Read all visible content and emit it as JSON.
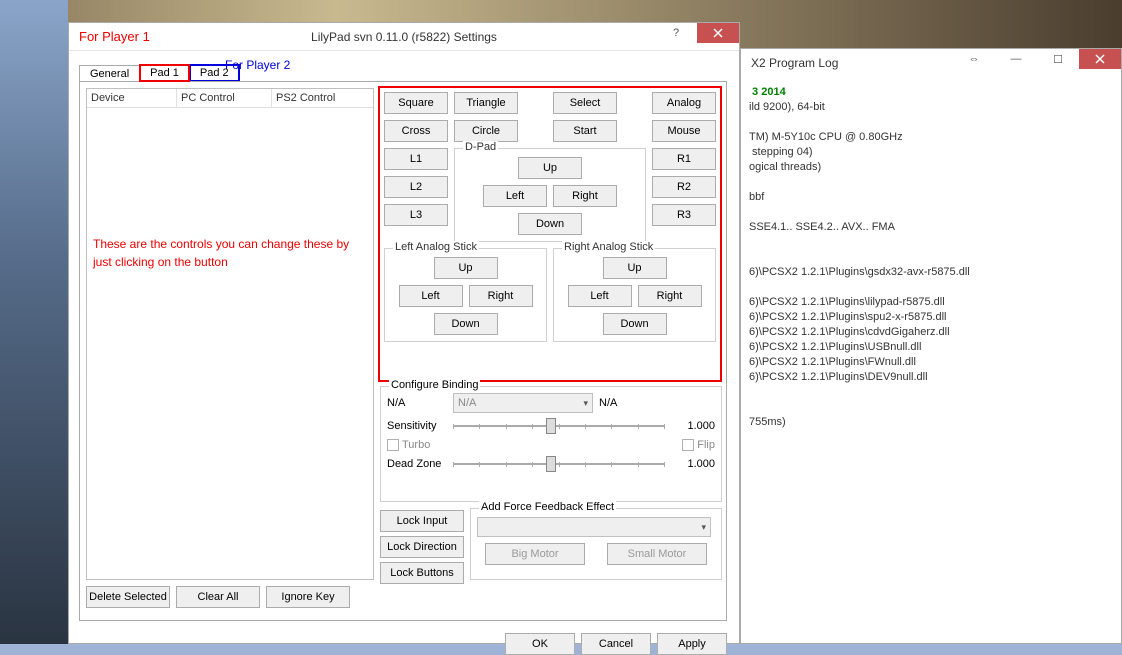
{
  "settings": {
    "title": "LilyPad svn 0.11.0 (r5822) Settings",
    "tabs": {
      "general": "General",
      "pad1": "Pad 1",
      "pad2": "Pad 2"
    },
    "list_headers": {
      "device": "Device",
      "pc": "PC Control",
      "ps2": "PS2 Control"
    },
    "under_list": {
      "delete": "Delete Selected",
      "clear": "Clear All",
      "ignore": "Ignore Key"
    },
    "face": {
      "square": "Square",
      "triangle": "Triangle",
      "cross": "Cross",
      "circle": "Circle"
    },
    "sys": {
      "select": "Select",
      "start": "Start",
      "analog": "Analog",
      "mouse": "Mouse"
    },
    "shoulders": {
      "l1": "L1",
      "l2": "L2",
      "l3": "L3",
      "r1": "R1",
      "r2": "R2",
      "r3": "R3"
    },
    "dpad": {
      "label": "D-Pad",
      "up": "Up",
      "down": "Down",
      "left": "Left",
      "right": "Right"
    },
    "lstick": {
      "label": "Left Analog Stick",
      "up": "Up",
      "down": "Down",
      "left": "Left",
      "right": "Right"
    },
    "rstick": {
      "label": "Right Analog Stick",
      "up": "Up",
      "down": "Down",
      "left": "Left",
      "right": "Right"
    },
    "cfg": {
      "label": "Configure Binding",
      "na1": "N/A",
      "combo": "N/A",
      "na2": "N/A",
      "sensitivity": "Sensitivity",
      "sens_val": "1.000",
      "turbo": "Turbo",
      "flip": "Flip",
      "deadzone": "Dead Zone",
      "dz_val": "1.000"
    },
    "lock": {
      "input": "Lock Input",
      "direction": "Lock Direction",
      "buttons": "Lock Buttons"
    },
    "ff": {
      "label": "Add Force Feedback Effect",
      "big": "Big Motor",
      "small": "Small Motor"
    },
    "footer": {
      "ok": "OK",
      "cancel": "Cancel",
      "apply": "Apply"
    }
  },
  "annot": {
    "p1": "For Player 1",
    "p2": "For Player 2",
    "desc": "These are the controls you can change these  by just clicking on the button"
  },
  "log": {
    "title": "X2 Program Log",
    "top": " 3 2014",
    "body": "ild 9200), 64-bit\n\nTM) M-5Y10c CPU @ 0.80GHz\n stepping 04)\nogical threads)\n\nbbf\n\nSSE4.1.. SSE4.2.. AVX.. FMA\n\n\n6)\\PCSX2 1.2.1\\Plugins\\gsdx32-avx-r5875.dll\n\n6)\\PCSX2 1.2.1\\Plugins\\lilypad-r5875.dll\n6)\\PCSX2 1.2.1\\Plugins\\spu2-x-r5875.dll\n6)\\PCSX2 1.2.1\\Plugins\\cdvdGigaherz.dll\n6)\\PCSX2 1.2.1\\Plugins\\USBnull.dll\n6)\\PCSX2 1.2.1\\Plugins\\FWnull.dll\n6)\\PCSX2 1.2.1\\Plugins\\DEV9null.dll\n\n\n755ms)"
  }
}
